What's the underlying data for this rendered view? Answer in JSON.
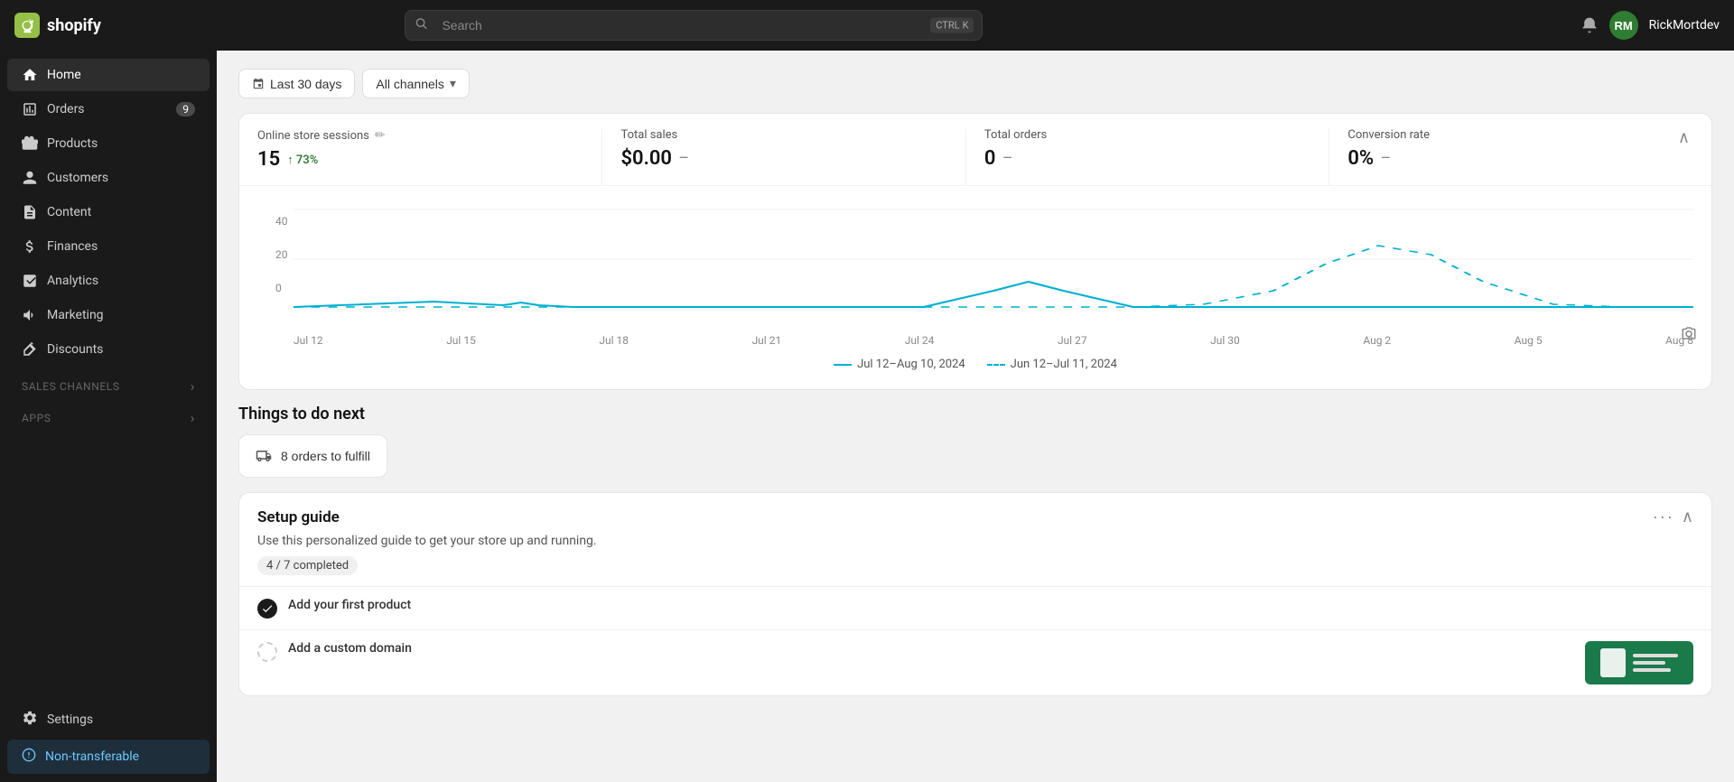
{
  "topbar": {
    "logo_text": "shopify",
    "search_placeholder": "Search",
    "search_shortcut_1": "CTRL",
    "search_shortcut_2": "K",
    "username": "RickMortdev"
  },
  "sidebar": {
    "items": [
      {
        "id": "home",
        "label": "Home",
        "icon": "home-icon",
        "active": true
      },
      {
        "id": "orders",
        "label": "Orders",
        "icon": "orders-icon",
        "badge": "9"
      },
      {
        "id": "products",
        "label": "Products",
        "icon": "products-icon"
      },
      {
        "id": "customers",
        "label": "Customers",
        "icon": "customers-icon"
      },
      {
        "id": "content",
        "label": "Content",
        "icon": "content-icon"
      },
      {
        "id": "finances",
        "label": "Finances",
        "icon": "finances-icon"
      },
      {
        "id": "analytics",
        "label": "Analytics",
        "icon": "analytics-icon"
      },
      {
        "id": "marketing",
        "label": "Marketing",
        "icon": "marketing-icon"
      },
      {
        "id": "discounts",
        "label": "Discounts",
        "icon": "discounts-icon"
      }
    ],
    "sales_channels_label": "Sales channels",
    "apps_label": "Apps",
    "settings_label": "Settings",
    "non_transferable_label": "Non-transferable"
  },
  "filters": {
    "date_label": "Last 30 days",
    "channel_label": "All channels"
  },
  "stats": {
    "sessions_label": "Online store sessions",
    "sessions_value": "15",
    "sessions_change": "↑ 73%",
    "total_sales_label": "Total sales",
    "total_sales_value": "$0.00",
    "total_sales_dash": "—",
    "total_orders_label": "Total orders",
    "total_orders_value": "0",
    "total_orders_dash": "—",
    "conversion_label": "Conversion rate",
    "conversion_value": "0%",
    "conversion_dash": "—"
  },
  "chart": {
    "y_labels": [
      "40",
      "20",
      "0"
    ],
    "x_labels": [
      "Jul 12",
      "Jul 15",
      "Jul 18",
      "Jul 21",
      "Jul 24",
      "Jul 27",
      "Jul 30",
      "Aug 2",
      "Aug 5",
      "Aug 8"
    ],
    "legend_current": "Jul 12–Aug 10, 2024",
    "legend_previous": "Jun 12–Jul 11, 2024"
  },
  "things_to_do": {
    "title": "Things to do next",
    "fulfill_label": "8 orders to fulfill"
  },
  "setup_guide": {
    "title": "Setup guide",
    "description": "Use this personalized guide to get your store up and running.",
    "progress": "4 / 7 completed",
    "items": [
      {
        "label": "Add your first product",
        "done": true
      },
      {
        "label": "Add a custom domain",
        "done": false
      }
    ]
  }
}
